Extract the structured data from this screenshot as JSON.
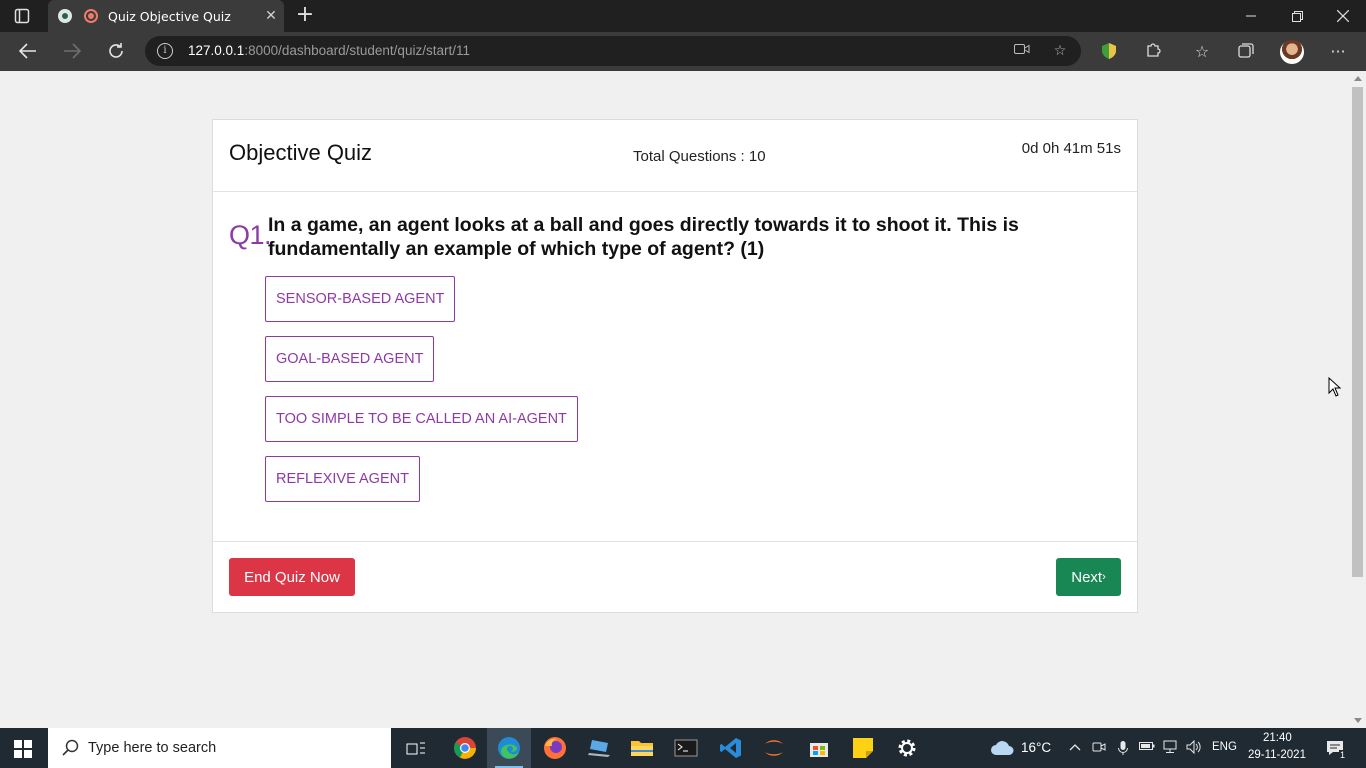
{
  "browser": {
    "tab_title": "Quiz Objective Quiz",
    "url_host": "127.0.0.1",
    "url_rest": ":8000/dashboard/student/quiz/start/11"
  },
  "quiz": {
    "title": "Objective Quiz",
    "total_questions": "Total Questions : 10",
    "timer": "0d 0h 41m 51s",
    "question_number": "Q1.",
    "question_text": "In a game, an agent looks at a ball and goes directly towards it to shoot it. This is fundamentally an example of which type of agent? (1)",
    "options": [
      "SENSOR-BASED AGENT",
      "GOAL-BASED AGENT",
      "TOO SIMPLE TO BE CALLED AN AI-AGENT",
      "REFLEXIVE AGENT"
    ],
    "end_button": "End Quiz Now",
    "next_button": "Next"
  },
  "taskbar": {
    "search_placeholder": "Type here to search",
    "weather_temp": "16°C",
    "language": "ENG",
    "time": "21:40",
    "date": "29-11-2021",
    "notification_count": "1"
  },
  "colors": {
    "accent_purple": "#8e3aa6",
    "danger": "#dc3545",
    "success": "#198754"
  }
}
